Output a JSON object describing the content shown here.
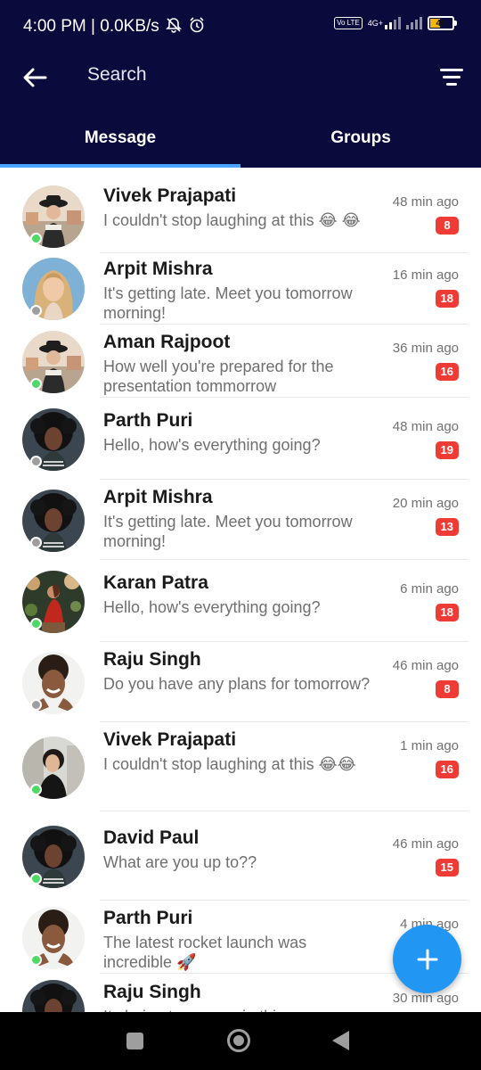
{
  "status_bar": {
    "time_speed": "4:00 PM | 0.0KB/s",
    "network": "4G+",
    "volte": "Vo LTE",
    "battery": "48"
  },
  "app_bar": {
    "search_label": "Search",
    "tabs": [
      {
        "label": "Message",
        "active": true
      },
      {
        "label": "Groups",
        "active": false
      }
    ]
  },
  "colors": {
    "header_bg": "#0a0a3c",
    "tab_indicator": "#4aa3ff",
    "badge": "#ef3b36",
    "online": "#4cd964",
    "offline": "#9e9e9e",
    "fab": "#2196f3"
  },
  "conversations": [
    {
      "name": "Vivek Prajapati",
      "message": "I couldn't stop laughing at this 😂 😂",
      "time": "48 min ago",
      "unread": "8",
      "online": true,
      "avatar": "woman-hat"
    },
    {
      "name": "Arpit Mishra",
      "message": "It's getting late. Meet you tomorrow morning!",
      "time": "16 min ago",
      "unread": "18",
      "online": false,
      "avatar": "blonde-woman"
    },
    {
      "name": "Aman Rajpoot",
      "message": "How well you're prepared for the presentation tommorrow",
      "time": "36 min ago",
      "unread": "16",
      "online": true,
      "avatar": "woman-hat"
    },
    {
      "name": "Parth Puri",
      "message": "Hello, how's everything going?",
      "time": "48 min ago",
      "unread": "19",
      "online": false,
      "avatar": "curly-woman"
    },
    {
      "name": "Arpit Mishra",
      "message": "It's getting late. Meet you tomorrow morning!",
      "time": "20 min ago",
      "unread": "13",
      "online": false,
      "avatar": "curly-woman"
    },
    {
      "name": "Karan Patra",
      "message": "Hello, how's everything going?",
      "time": "6 min ago",
      "unread": "18",
      "online": true,
      "avatar": "woman-red-dress"
    },
    {
      "name": "Raju Singh",
      "message": "Do you have any plans for tomorrow?",
      "time": "46 min ago",
      "unread": "8",
      "online": false,
      "avatar": "smiling-woman"
    },
    {
      "name": "Vivek Prajapati",
      "message": "I couldn't stop laughing at this 😂😂",
      "time": "1 min ago",
      "unread": "16",
      "online": true,
      "avatar": "woman-street"
    },
    {
      "name": "David Paul",
      "message": "What are you up to??",
      "time": "46 min ago",
      "unread": "15",
      "online": true,
      "avatar": "curly-woman"
    },
    {
      "name": "Parth Puri",
      "message": "The latest rocket launch was incredible 🚀",
      "time": "4 min ago",
      "unread": "",
      "online": true,
      "avatar": "smiling-woman"
    },
    {
      "name": "Raju Singh",
      "message": "Its being too sunny in this",
      "time": "30 min ago",
      "unread": "",
      "online": false,
      "avatar": "curly-woman"
    }
  ],
  "fab": {
    "icon": "plus-icon"
  },
  "nav_bar": {
    "icons": [
      "recents-icon",
      "home-icon",
      "back-icon"
    ]
  }
}
